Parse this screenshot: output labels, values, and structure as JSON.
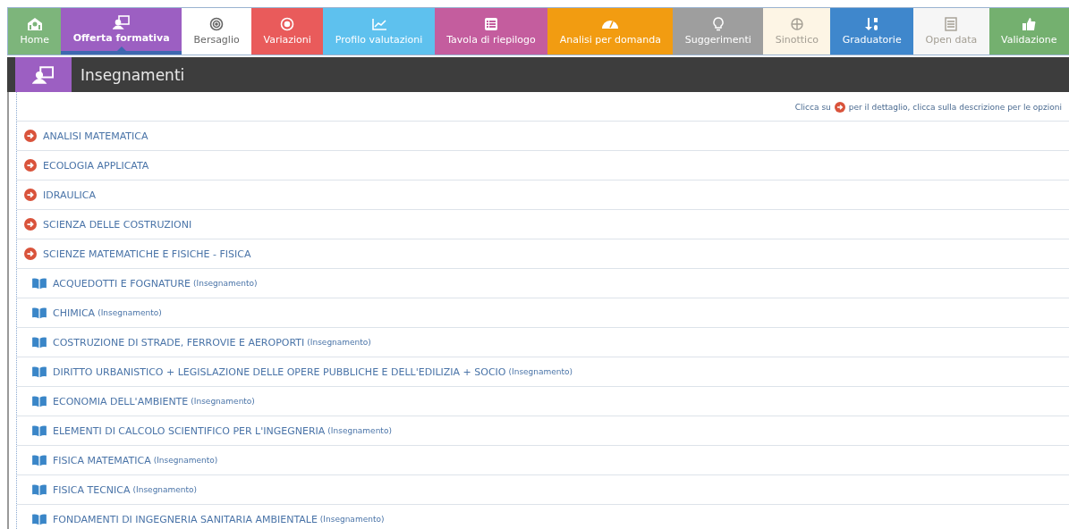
{
  "nav_tabs": [
    {
      "label": "Home",
      "color": "#7db57b",
      "selected": false,
      "disabled": false
    },
    {
      "label": "Offerta formativa",
      "color": "#9c5fc2",
      "selected": true,
      "disabled": false
    },
    {
      "label": "Bersaglio",
      "color": "#ffffff",
      "selected": false,
      "disabled": false
    },
    {
      "label": "Variazioni",
      "color": "#e95b5b",
      "selected": false,
      "disabled": false
    },
    {
      "label": "Profilo valutazioni",
      "color": "#5ec1ee",
      "selected": false,
      "disabled": false
    },
    {
      "label": "Tavola di riepilogo",
      "color": "#c45d9e",
      "selected": false,
      "disabled": false
    },
    {
      "label": "Analisi per domanda",
      "color": "#f29c11",
      "selected": false,
      "disabled": false
    },
    {
      "label": "Suggerimenti",
      "color": "#9e9e9e",
      "selected": false,
      "disabled": false
    },
    {
      "label": "Sinottico",
      "color": "#fdf4e3",
      "selected": false,
      "disabled": true
    },
    {
      "label": "Graduatorie",
      "color": "#3f87cc",
      "selected": false,
      "disabled": false
    },
    {
      "label": "Open data",
      "color": "#f6f6f6",
      "selected": false,
      "disabled": true
    },
    {
      "label": "Validazione",
      "color": "#74b06f",
      "selected": false,
      "disabled": false
    }
  ],
  "section": {
    "title": "Insegnamenti"
  },
  "hint": {
    "before": "Clicca su",
    "after": "per il dettaglio, clicca sulla descrizione per le opzioni"
  },
  "courses": [
    {
      "title": "ANALISI MATEMATICA"
    },
    {
      "title": "ECOLOGIA APPLICATA"
    },
    {
      "title": "IDRAULICA"
    },
    {
      "title": "SCIENZA DELLE COSTRUZIONI"
    },
    {
      "title": "SCIENZE MATEMATICHE E FISICHE - FISICA",
      "children": [
        {
          "title": "ACQUEDOTTI E FOGNATURE",
          "type": "(Insegnamento)"
        },
        {
          "title": "CHIMICA",
          "type": "(Insegnamento)"
        },
        {
          "title": "COSTRUZIONE DI STRADE, FERROVIE E AEROPORTI",
          "type": "(Insegnamento)"
        },
        {
          "title": "DIRITTO URBANISTICO + LEGISLAZIONE DELLE OPERE PUBBLICHE E DELL'EDILIZIA + SOCIO",
          "type": "(Insegnamento)"
        },
        {
          "title": "ECONOMIA DELL'AMBIENTE",
          "type": "(Insegnamento)"
        },
        {
          "title": "ELEMENTI DI CALCOLO SCIENTIFICO PER L'INGEGNERIA",
          "type": "(Insegnamento)"
        },
        {
          "title": "FISICA MATEMATICA",
          "type": "(Insegnamento)"
        },
        {
          "title": "FISICA TECNICA",
          "type": "(Insegnamento)"
        },
        {
          "title": "FONDAMENTI DI INGEGNERIA SANITARIA AMBIENTALE",
          "type": "(Insegnamento)"
        }
      ]
    }
  ]
}
